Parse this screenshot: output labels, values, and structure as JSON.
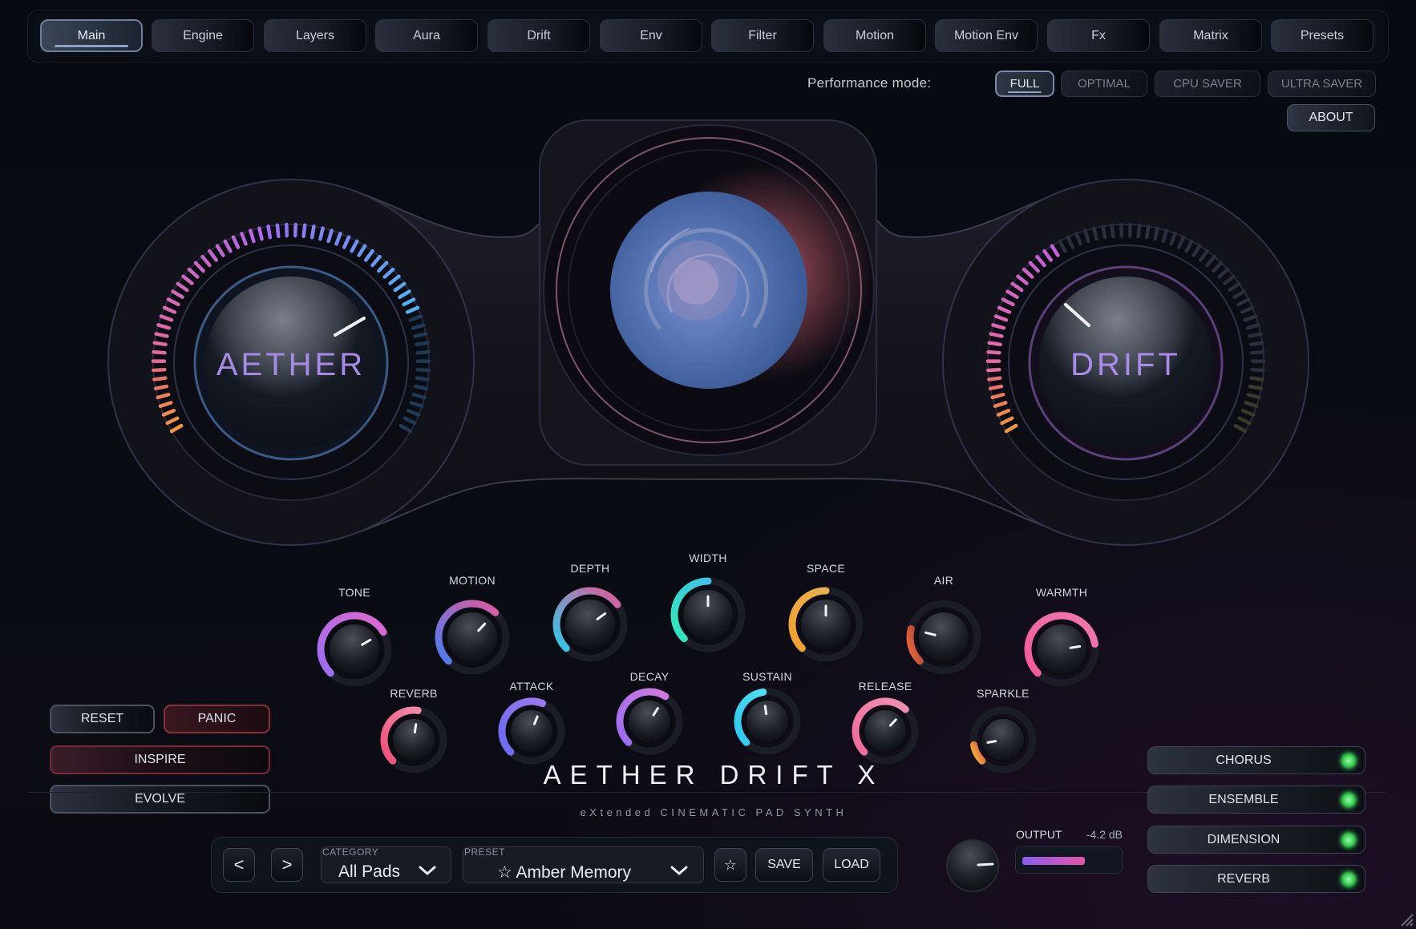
{
  "tabs": [
    "Main",
    "Engine",
    "Layers",
    "Aura",
    "Drift",
    "Env",
    "Filter",
    "Motion",
    "Motion Env",
    "Fx",
    "Matrix",
    "Presets"
  ],
  "active_tab": "Main",
  "performance": {
    "label": "Performance mode:",
    "modes": [
      "FULL",
      "OPTIMAL",
      "CPU SAVER",
      "ULTRA SAVER"
    ],
    "selected": "FULL"
  },
  "about_label": "ABOUT",
  "big_knobs": {
    "left": {
      "label": "AETHER",
      "accent": "#9a7be0"
    },
    "right": {
      "label": "DRIFT",
      "accent": "#a98be8"
    }
  },
  "knobs_row1": [
    {
      "label": "TONE",
      "value": 0.72
    },
    {
      "label": "MOTION",
      "value": 0.66
    },
    {
      "label": "DEPTH",
      "value": 0.7
    },
    {
      "label": "WIDTH",
      "value": 0.5
    },
    {
      "label": "SPACE",
      "value": 0.5
    },
    {
      "label": "AIR",
      "value": 0.22
    },
    {
      "label": "WARMTH",
      "value": 0.8
    }
  ],
  "knobs_row2": [
    {
      "label": "REVERB",
      "value": 0.53
    },
    {
      "label": "ATTACK",
      "value": 0.58
    },
    {
      "label": "DECAY",
      "value": 0.62
    },
    {
      "label": "SUSTAIN",
      "value": 0.47
    },
    {
      "label": "RELEASE",
      "value": 0.66
    },
    {
      "label": "SPARKLE",
      "value": 0.13
    }
  ],
  "side_buttons": {
    "reset": "RESET",
    "panic": "PANIC",
    "inspire": "INSPIRE",
    "evolve": "EVOLVE"
  },
  "title": "AETHER DRIFT X",
  "subtitle": "eXtended CINEMATIC PAD SYNTH",
  "preset_bar": {
    "prev": "<",
    "next": ">",
    "category_caption": "CATEGORY",
    "category_value": "All Pads",
    "preset_caption": "PRESET",
    "preset_value": "☆ Amber Memory",
    "favorite": "☆",
    "save": "SAVE",
    "load": "LOAD"
  },
  "output": {
    "label": "OUTPUT",
    "value": "-4.2 dB",
    "level": 0.66
  },
  "fx_toggles": [
    "CHORUS",
    "ENSEMBLE",
    "DIMENSION",
    "REVERB"
  ],
  "colors": {
    "background": "#06080e",
    "accent_violet": "#8a5cf0",
    "accent_pink": "#e257a8",
    "led_green": "#3ed45a"
  }
}
